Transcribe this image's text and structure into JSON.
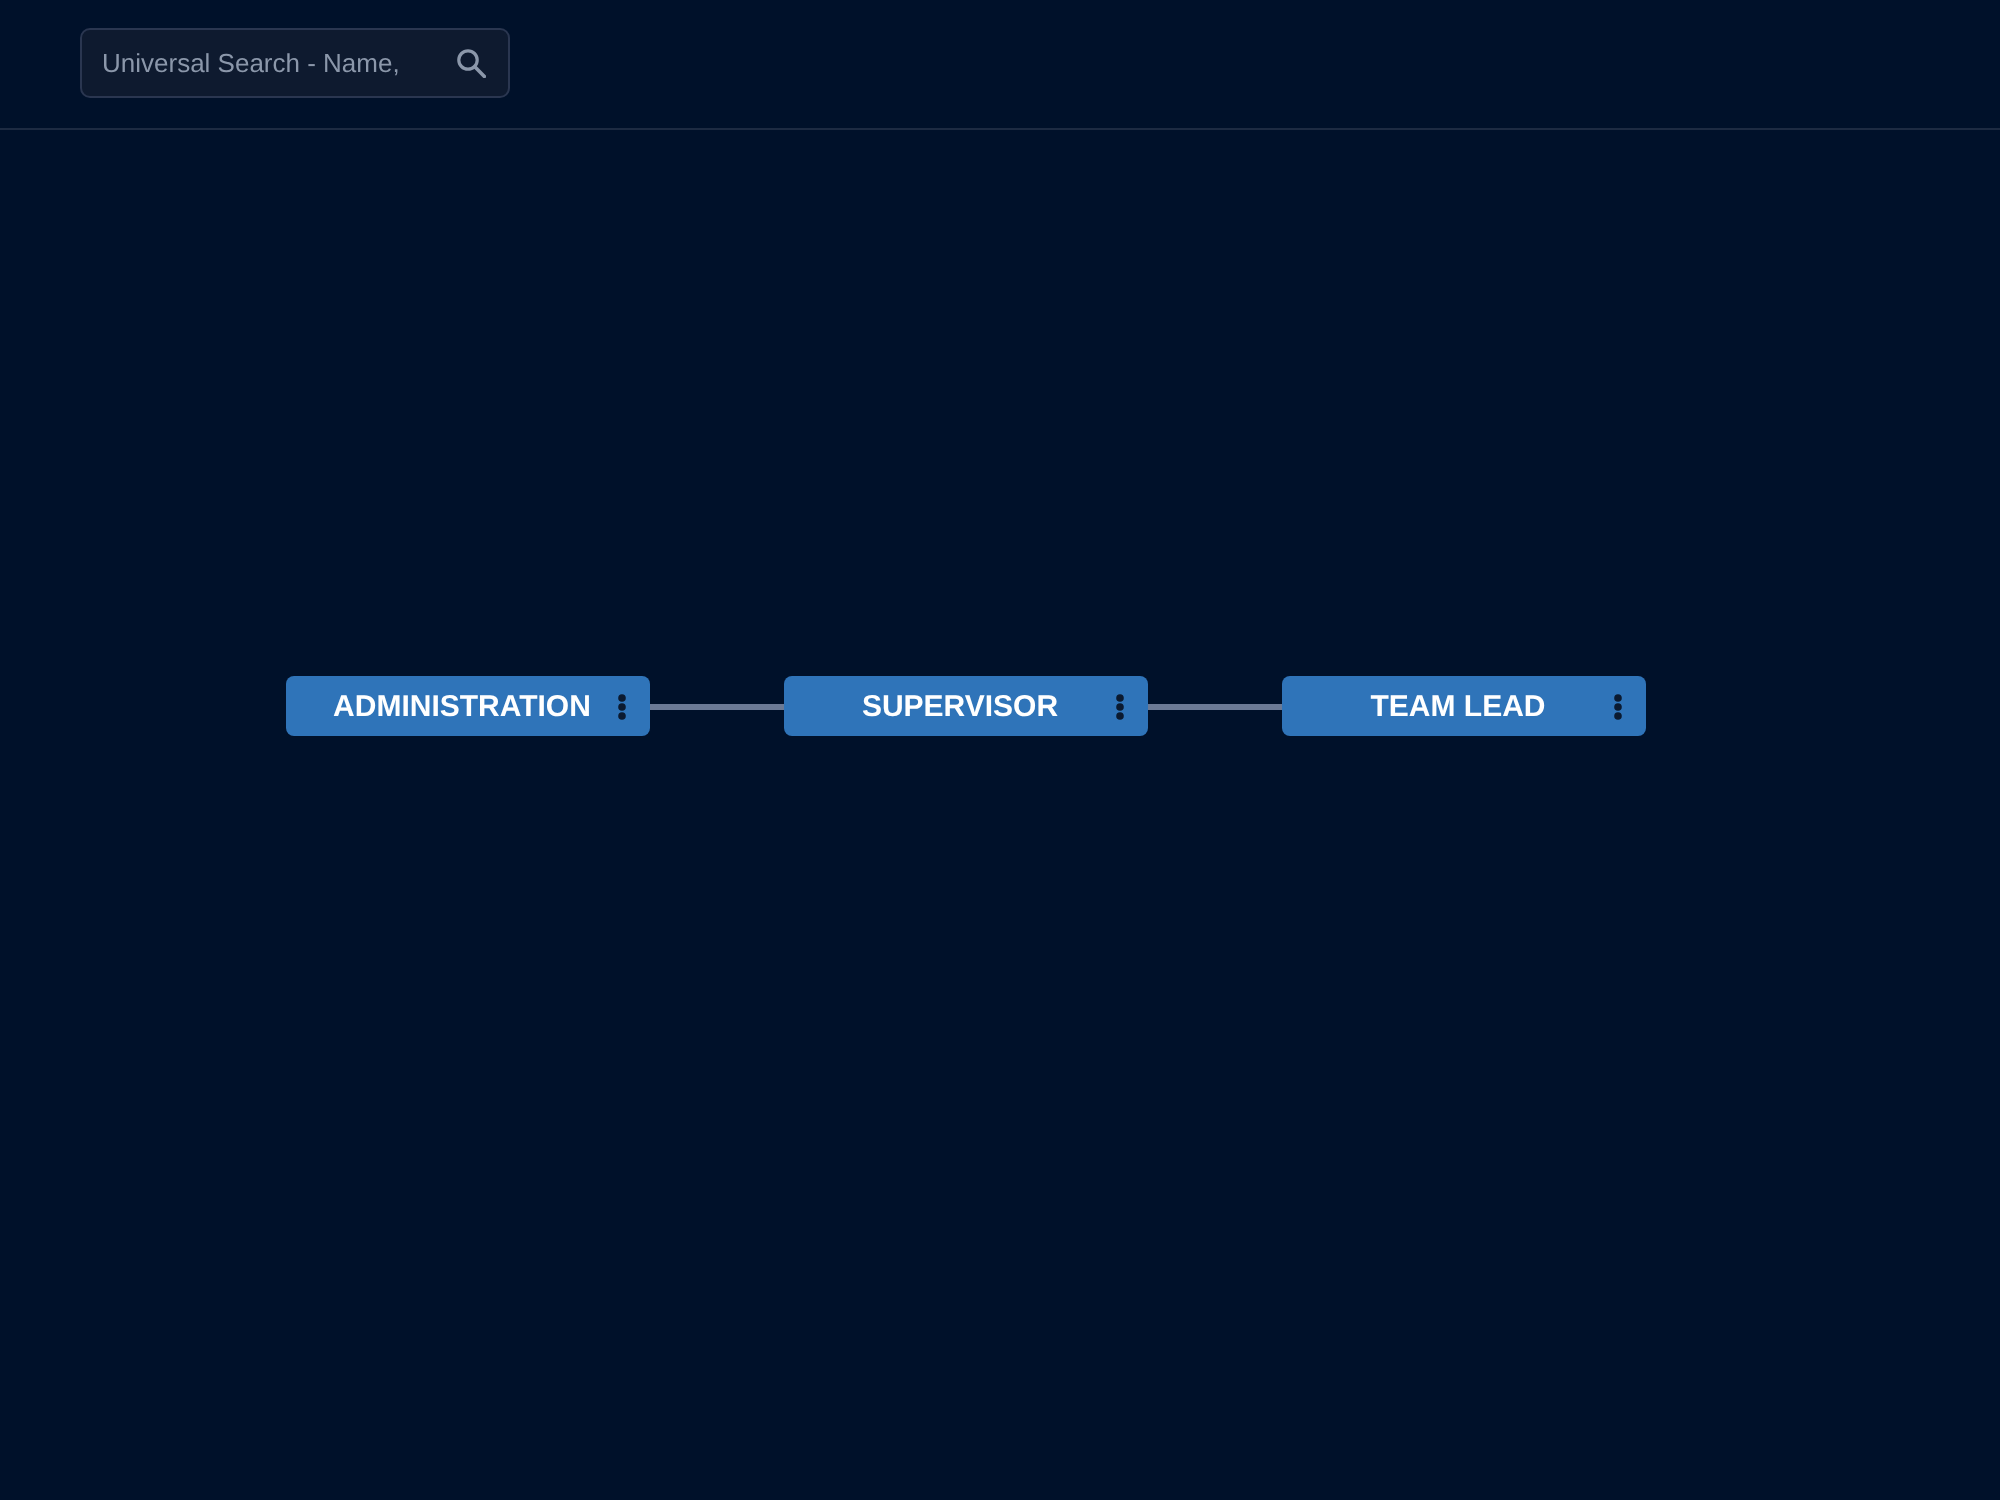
{
  "search": {
    "placeholder": "Universal Search - Name,"
  },
  "org_chart": {
    "nodes": [
      {
        "label": "ADMINISTRATION"
      },
      {
        "label": "SUPERVISOR"
      },
      {
        "label": "TEAM LEAD"
      }
    ]
  }
}
